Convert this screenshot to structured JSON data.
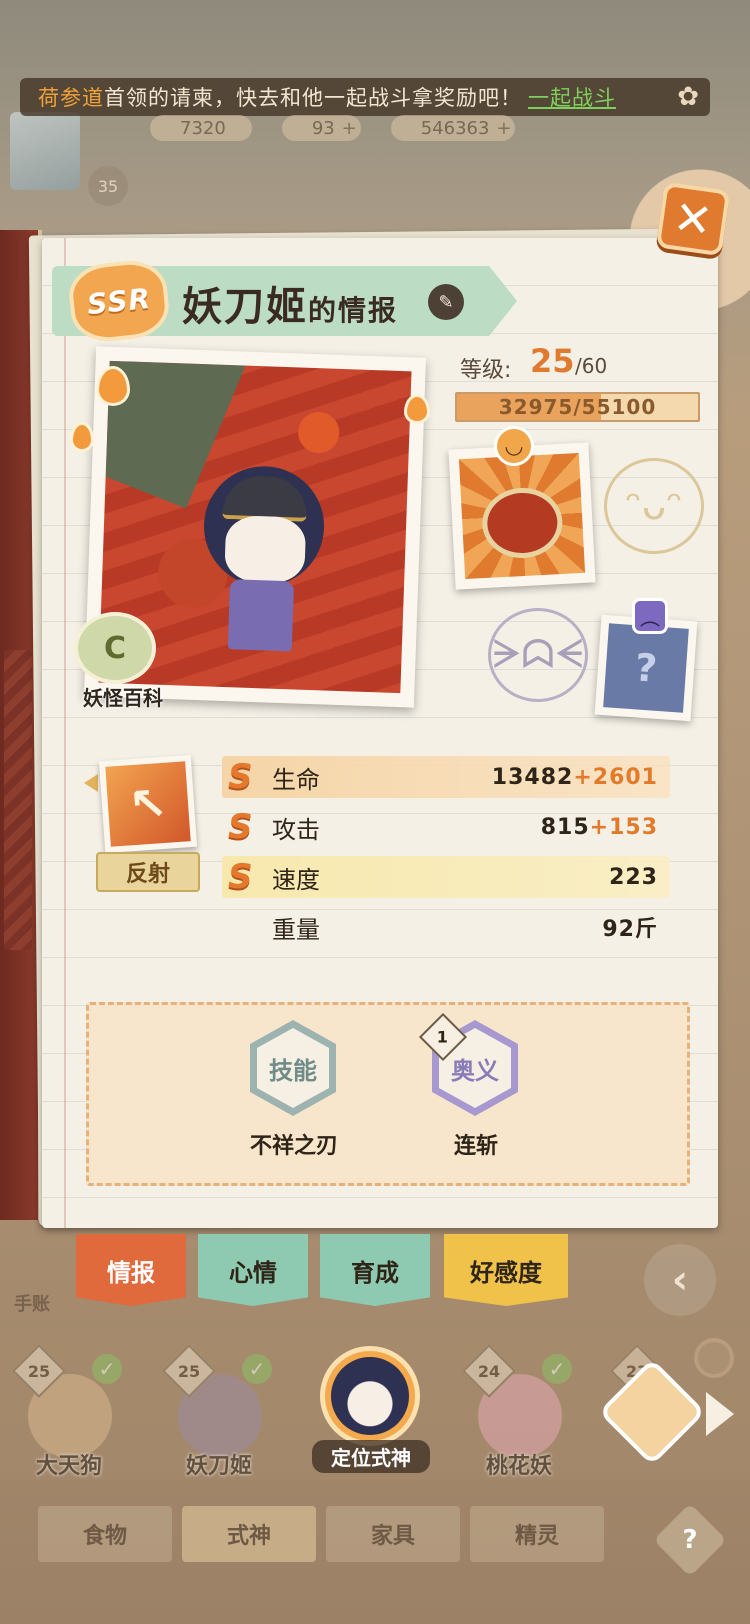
{
  "notice": {
    "highlight": "荷参道",
    "text": "首领的请柬，快去和他一起战斗拿奖励吧！",
    "action": "一起战斗"
  },
  "resources": [
    "7320",
    "93",
    "546363"
  ],
  "avatar_badge": "35",
  "title": {
    "rarity": "SSR",
    "name": "妖刀姬",
    "suffix": "的情报"
  },
  "level": {
    "label": "等级:",
    "value": "25",
    "max": "/60",
    "exp_text": "32975/55100",
    "exp_fraction": 0.598
  },
  "encyclopedia_label": "妖怪百科",
  "attribute": {
    "label": "反射",
    "color": "#e4782c"
  },
  "stats": [
    {
      "name": "生命",
      "base": "13482",
      "bonus": "+2601"
    },
    {
      "name": "攻击",
      "base": "815",
      "bonus": "+153"
    },
    {
      "name": "速度",
      "base": "223",
      "bonus": ""
    },
    {
      "name": "重量",
      "base": "92斤",
      "bonus": ""
    }
  ],
  "skills": [
    {
      "badge": "技能",
      "name": "不祥之刃"
    },
    {
      "badge": "奥义",
      "name": "连斩",
      "count": "1"
    }
  ],
  "tabs": [
    {
      "label": "情报",
      "color": "#e06a3c",
      "active": true
    },
    {
      "label": "心情",
      "color": "#8ec9b2",
      "active": false
    },
    {
      "label": "育成",
      "color": "#8ec9b2",
      "active": false
    },
    {
      "label": "好感度",
      "color": "#f0c24a",
      "active": false
    }
  ],
  "handbook_label": "手账",
  "roster": [
    {
      "level": "25",
      "name": "大天狗"
    },
    {
      "level": "25",
      "name": "妖刀姬"
    },
    {
      "level": "24",
      "name": "桃花妖"
    }
  ],
  "locate_label": "定位式神",
  "next_level": "23",
  "categories": [
    "食物",
    "式神",
    "家具",
    "精灵"
  ],
  "help_icon": "?",
  "icons": {
    "close": "close-icon",
    "edit": "pencil-icon",
    "back": "back-icon"
  }
}
